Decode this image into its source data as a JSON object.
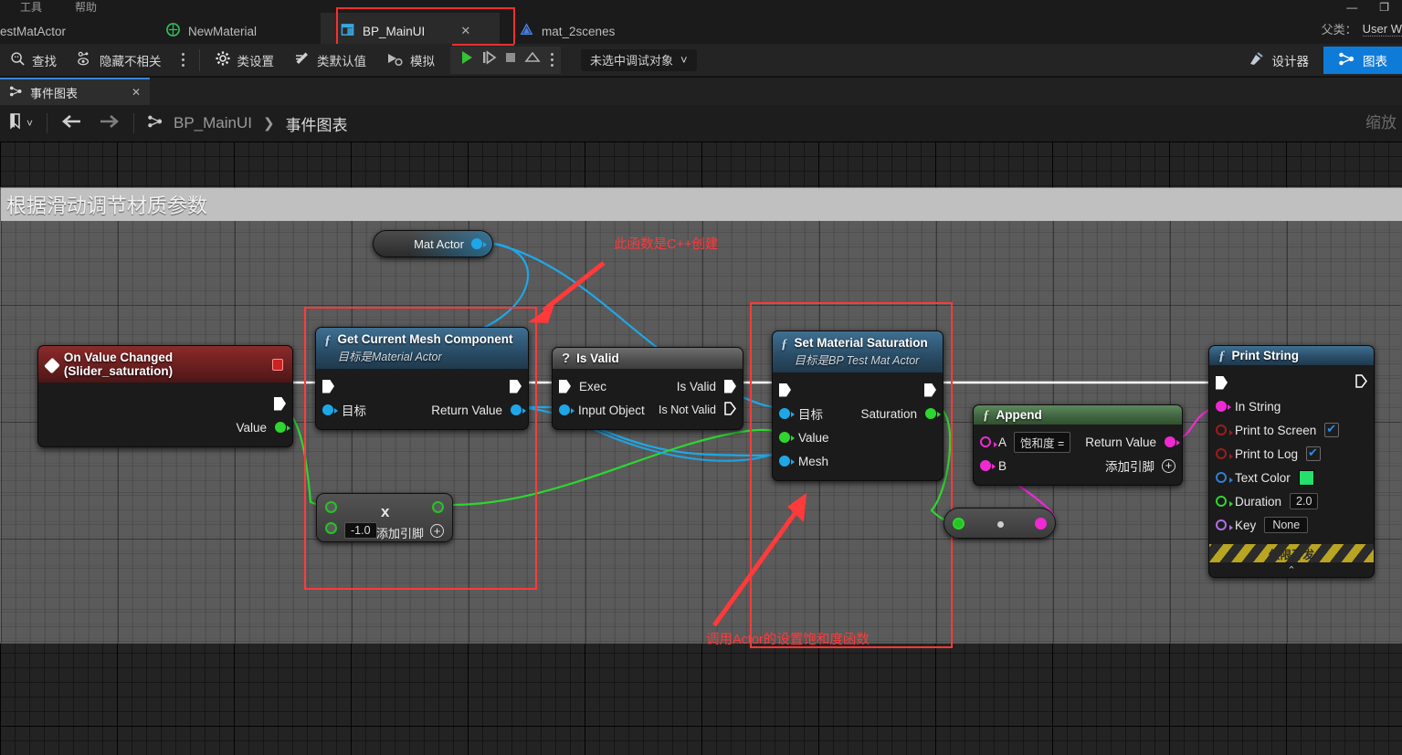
{
  "menubar": {
    "items": [
      "工具",
      "帮助"
    ]
  },
  "window_controls": {
    "minimize": "—",
    "restore": "❐"
  },
  "asset_tabs": [
    {
      "label": "estMatActor",
      "icon": "blueprint-icon",
      "active": false
    },
    {
      "label": "NewMaterial",
      "icon": "material-icon",
      "active": false
    },
    {
      "label": "BP_MainUI",
      "icon": "widget-blueprint-icon",
      "active": true,
      "close": "✕",
      "highlighted": true
    },
    {
      "label": "mat_2scenes",
      "icon": "material-instance-icon",
      "active": false
    }
  ],
  "parent_class": {
    "label": "父类：",
    "value": "User W"
  },
  "toolbar": {
    "find": "查找",
    "hide_unrelated": "隐藏不相关",
    "class_settings": "类设置",
    "class_defaults": "类默认值",
    "simulate": "模拟",
    "debug_object": "未选中调试对象",
    "designer": "设计器",
    "graph": "图表"
  },
  "graph_tab": {
    "label": "事件图表",
    "close": "✕"
  },
  "breadcrumb": {
    "root": "BP_MainUI",
    "separator": "❯",
    "current": "事件图表",
    "back": "←",
    "forward": "→",
    "zoom_label": "缩放"
  },
  "comment": {
    "title": "根据滑动调节材质参数"
  },
  "annotations": [
    {
      "name": "cpp-created-note",
      "text": "此函数是C++创建"
    },
    {
      "name": "actor-saturation-note",
      "text": "调用Actor的设置饱和度函数"
    }
  ],
  "nodes": {
    "mat_actor": {
      "title": "Mat Actor"
    },
    "on_value_changed": {
      "title": "On Value Changed (Slider_saturation)",
      "out_value": "Value"
    },
    "get_current_mesh": {
      "title": "Get Current Mesh Component",
      "subtitle": "目标是Material Actor",
      "in_target": "目标",
      "out_return": "Return Value"
    },
    "is_valid": {
      "title": "Is Valid",
      "in_exec": "Exec",
      "in_object": "Input Object",
      "out_valid": "Is Valid",
      "out_not_valid": "Is Not Valid"
    },
    "set_material_saturation": {
      "title": "Set Material Saturation",
      "subtitle": "目标是BP Test Mat Actor",
      "in_target": "目标",
      "in_value": "Value",
      "in_mesh": "Mesh",
      "out_saturation": "Saturation"
    },
    "multiply": {
      "operator": "x",
      "value_b": "-1.0",
      "add_pin": "添加引脚",
      "plus": "+"
    },
    "to_string": {
      "title": ""
    },
    "append": {
      "title": "Append",
      "in_a_label": "A",
      "in_a_value": "饱和度 =",
      "in_b_label": "B",
      "out_return": "Return Value",
      "add_pin": "添加引脚",
      "plus": "+"
    },
    "print_string": {
      "title": "Print String",
      "in_string": "In String",
      "print_to_screen": "Print to Screen",
      "print_to_screen_checked": true,
      "print_to_log": "Print to Log",
      "print_to_log_checked": true,
      "text_color": "Text Color",
      "text_color_value": "#25e06a",
      "duration": "Duration",
      "duration_value": "2.0",
      "key": "Key",
      "key_value": "None",
      "dev_only": "仅限开发",
      "collapse": "⌃"
    }
  },
  "colors": {
    "exec_wire": "#ffffff",
    "object_wire": "#1ea7e8",
    "float_wire": "#2fd62f",
    "string_wire": "#ef2ad2",
    "accent_blue": "#0f7bd8",
    "annotation_red": "#ff3a3a"
  }
}
